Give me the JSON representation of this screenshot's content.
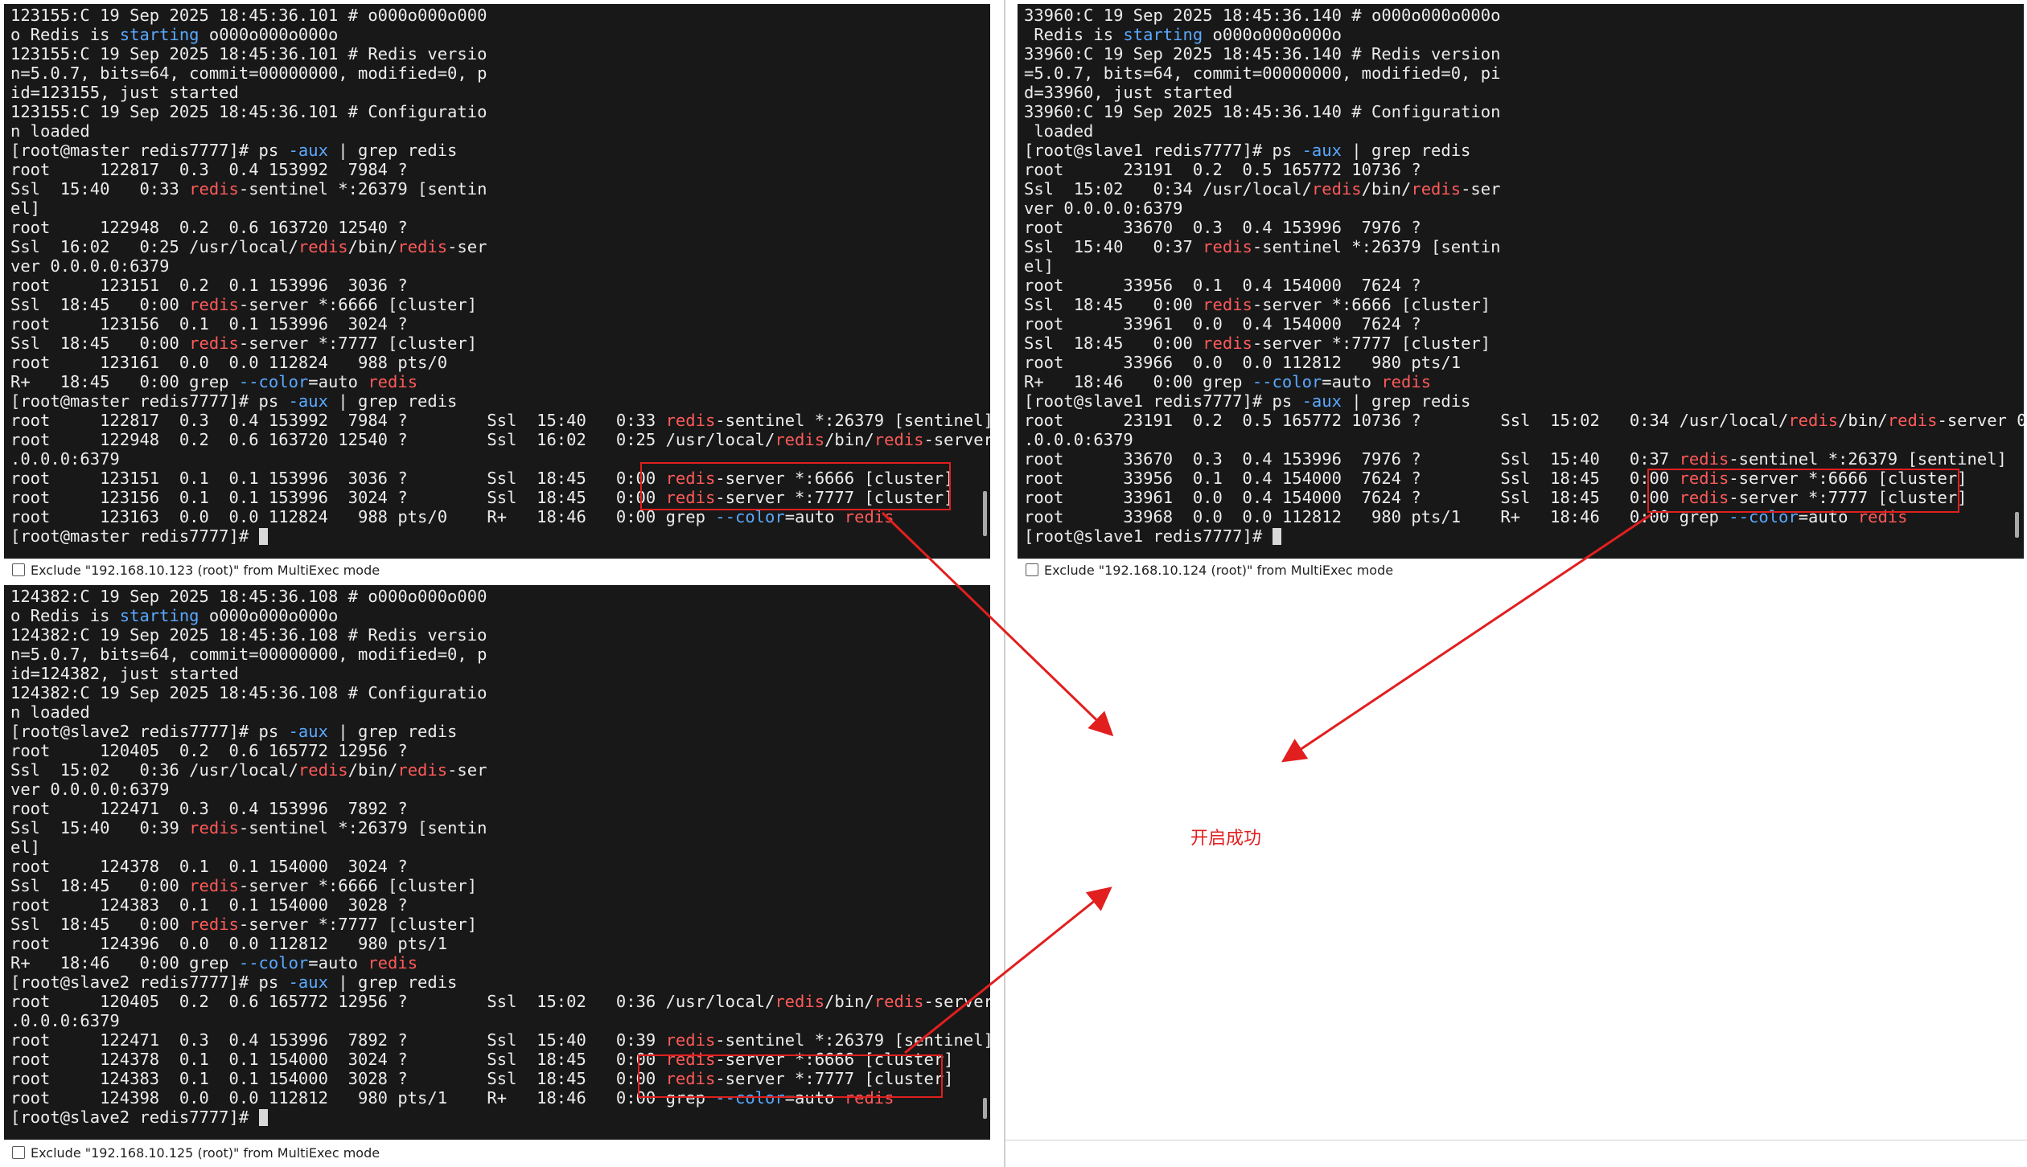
{
  "colors": {
    "terminal_bg": "#181818",
    "text": "#ececec",
    "redis_highlight": "#ff5a5a",
    "flag_highlight": "#5aa9ff",
    "annotation": "#e11f1f"
  },
  "panes": [
    {
      "host": "master",
      "exclude_label": "Exclude \"192.168.10.123 (root)\" from MultiExec mode",
      "lines": [
        [
          [
            "123155:C 19 Sep 2025 18:45:36.101 # o000o000o000",
            ""
          ]
        ],
        [
          [
            "o Redis is ",
            ""
          ],
          [
            "starting",
            "b"
          ],
          [
            " o000o000o000o",
            ""
          ]
        ],
        [
          [
            "123155:C 19 Sep 2025 18:45:36.101 # Redis versio",
            ""
          ]
        ],
        [
          [
            "n=5.0.7, bits=64, commit=00000000, modified=0, p",
            ""
          ]
        ],
        [
          [
            "id=123155, just started",
            ""
          ]
        ],
        [
          [
            "123155:C 19 Sep 2025 18:45:36.101 # Configuratio",
            ""
          ]
        ],
        [
          [
            "n loaded",
            ""
          ]
        ],
        [
          [
            "[root@master redis7777]# ps ",
            ""
          ],
          [
            "-aux",
            "b"
          ],
          [
            " | grep redis",
            ""
          ]
        ],
        [
          [
            "root     122817  0.3  0.4 153992  7984 ?",
            ""
          ]
        ],
        [
          [
            "Ssl  15:40   0:33 ",
            ""
          ],
          [
            "redis",
            "r"
          ],
          [
            "-sentinel *:26379 [sentin",
            ""
          ]
        ],
        [
          [
            "el]",
            ""
          ]
        ],
        [
          [
            "root     122948  0.2  0.6 163720 12540 ?",
            ""
          ]
        ],
        [
          [
            "Ssl  16:02   0:25 /usr/local/",
            ""
          ],
          [
            "redis",
            "r"
          ],
          [
            "/bin/",
            ""
          ],
          [
            "redis",
            "r"
          ],
          [
            "-ser",
            ""
          ]
        ],
        [
          [
            "ver 0.0.0.0:6379",
            ""
          ]
        ],
        [
          [
            "root     123151  0.2  0.1 153996  3036 ?",
            ""
          ]
        ],
        [
          [
            "Ssl  18:45   0:00 ",
            ""
          ],
          [
            "redis",
            "r"
          ],
          [
            "-server *:6666 [cluster]",
            ""
          ]
        ],
        [
          [
            "root     123156  0.1  0.1 153996  3024 ?",
            ""
          ]
        ],
        [
          [
            "Ssl  18:45   0:00 ",
            ""
          ],
          [
            "redis",
            "r"
          ],
          [
            "-server *:7777 [cluster]",
            ""
          ]
        ],
        [
          [
            "root     123161  0.0  0.0 112824   988 pts/0",
            ""
          ]
        ],
        [
          [
            "R+   18:45   0:00 grep ",
            ""
          ],
          [
            "--color",
            "b"
          ],
          [
            "=auto ",
            ""
          ],
          [
            "redis",
            "r"
          ]
        ],
        [
          [
            "[root@master redis7777]# ps ",
            ""
          ],
          [
            "-aux",
            "b"
          ],
          [
            " | grep redis",
            ""
          ]
        ],
        [
          [
            "root     122817  0.3  0.4 153992  7984 ?        Ssl  15:40   0:33 ",
            ""
          ],
          [
            "redis",
            "r"
          ],
          [
            "-sentinel *:26379 [sentinel]",
            ""
          ]
        ],
        [
          [
            "root     122948  0.2  0.6 163720 12540 ?        Ssl  16:02   0:25 /usr/local/",
            ""
          ],
          [
            "redis",
            "r"
          ],
          [
            "/bin/",
            ""
          ],
          [
            "redis",
            "r"
          ],
          [
            "-server 0",
            ""
          ]
        ],
        [
          [
            ".0.0.0:6379",
            ""
          ]
        ],
        [
          [
            "root     123151  0.1  0.1 153996  3036 ?        Ssl  18:45   0:00 ",
            ""
          ],
          [
            "redis",
            "r"
          ],
          [
            "-server *:6666 [cluster]",
            ""
          ]
        ],
        [
          [
            "root     123156  0.1  0.1 153996  3024 ?        Ssl  18:45   0:00 ",
            ""
          ],
          [
            "redis",
            "r"
          ],
          [
            "-server *:7777 [cluster]",
            ""
          ]
        ],
        [
          [
            "root     123163  0.0  0.0 112824   988 pts/0    R+   18:46   0:00 grep ",
            ""
          ],
          [
            "--color",
            "b"
          ],
          [
            "=auto ",
            ""
          ],
          [
            "redis",
            "r"
          ]
        ],
        [
          [
            "[root@master redis7777]# ",
            ""
          ],
          [
            "",
            "c"
          ]
        ]
      ]
    },
    {
      "host": "slave1",
      "exclude_label": "Exclude \"192.168.10.124 (root)\" from MultiExec mode",
      "lines": [
        [
          [
            "33960:C 19 Sep 2025 18:45:36.140 # o000o000o000o",
            ""
          ]
        ],
        [
          [
            " Redis is ",
            ""
          ],
          [
            "starting",
            "b"
          ],
          [
            " o000o000o000o",
            ""
          ]
        ],
        [
          [
            "33960:C 19 Sep 2025 18:45:36.140 # Redis version",
            ""
          ]
        ],
        [
          [
            "=5.0.7, bits=64, commit=00000000, modified=0, pi",
            ""
          ]
        ],
        [
          [
            "d=33960, just started",
            ""
          ]
        ],
        [
          [
            "33960:C 19 Sep 2025 18:45:36.140 # Configuration",
            ""
          ]
        ],
        [
          [
            " loaded",
            ""
          ]
        ],
        [
          [
            "[root@slave1 redis7777]# ps ",
            ""
          ],
          [
            "-aux",
            "b"
          ],
          [
            " | grep redis",
            ""
          ]
        ],
        [
          [
            "root      23191  0.2  0.5 165772 10736 ?",
            ""
          ]
        ],
        [
          [
            "Ssl  15:02   0:34 /usr/local/",
            ""
          ],
          [
            "redis",
            "r"
          ],
          [
            "/bin/",
            ""
          ],
          [
            "redis",
            "r"
          ],
          [
            "-ser",
            ""
          ]
        ],
        [
          [
            "ver 0.0.0.0:6379",
            ""
          ]
        ],
        [
          [
            "root      33670  0.3  0.4 153996  7976 ?",
            ""
          ]
        ],
        [
          [
            "Ssl  15:40   0:37 ",
            ""
          ],
          [
            "redis",
            "r"
          ],
          [
            "-sentinel *:26379 [sentin",
            ""
          ]
        ],
        [
          [
            "el]",
            ""
          ]
        ],
        [
          [
            "root      33956  0.1  0.4 154000  7624 ?",
            ""
          ]
        ],
        [
          [
            "Ssl  18:45   0:00 ",
            ""
          ],
          [
            "redis",
            "r"
          ],
          [
            "-server *:6666 [cluster]",
            ""
          ]
        ],
        [
          [
            "root      33961  0.0  0.4 154000  7624 ?",
            ""
          ]
        ],
        [
          [
            "Ssl  18:45   0:00 ",
            ""
          ],
          [
            "redis",
            "r"
          ],
          [
            "-server *:7777 [cluster]",
            ""
          ]
        ],
        [
          [
            "root      33966  0.0  0.0 112812   980 pts/1",
            ""
          ]
        ],
        [
          [
            "R+   18:46   0:00 grep ",
            ""
          ],
          [
            "--color",
            "b"
          ],
          [
            "=auto ",
            ""
          ],
          [
            "redis",
            "r"
          ]
        ],
        [
          [
            "[root@slave1 redis7777]# ps ",
            ""
          ],
          [
            "-aux",
            "b"
          ],
          [
            " | grep redis",
            ""
          ]
        ],
        [
          [
            "root      23191  0.2  0.5 165772 10736 ?        Ssl  15:02   0:34 /usr/local/",
            ""
          ],
          [
            "redis",
            "r"
          ],
          [
            "/bin/",
            ""
          ],
          [
            "redis",
            "r"
          ],
          [
            "-server 0",
            ""
          ]
        ],
        [
          [
            ".0.0.0:6379",
            ""
          ]
        ],
        [
          [
            "root      33670  0.3  0.4 153996  7976 ?        Ssl  15:40   0:37 ",
            ""
          ],
          [
            "redis",
            "r"
          ],
          [
            "-sentinel *:26379 [sentinel]",
            ""
          ]
        ],
        [
          [
            "root      33956  0.1  0.4 154000  7624 ?        Ssl  18:45   0:00 ",
            ""
          ],
          [
            "redis",
            "r"
          ],
          [
            "-server *:6666 [cluster]",
            ""
          ]
        ],
        [
          [
            "root      33961  0.0  0.4 154000  7624 ?        Ssl  18:45   0:00 ",
            ""
          ],
          [
            "redis",
            "r"
          ],
          [
            "-server *:7777 [cluster]",
            ""
          ]
        ],
        [
          [
            "root      33968  0.0  0.0 112812   980 pts/1    R+   18:46   0:00 grep ",
            ""
          ],
          [
            "--color",
            "b"
          ],
          [
            "=auto ",
            ""
          ],
          [
            "redis",
            "r"
          ]
        ],
        [
          [
            "[root@slave1 redis7777]# ",
            ""
          ],
          [
            "",
            "c"
          ]
        ]
      ]
    },
    {
      "host": "slave2",
      "exclude_label": "Exclude \"192.168.10.125 (root)\" from MultiExec mode",
      "lines": [
        [
          [
            "124382:C 19 Sep 2025 18:45:36.108 # o000o000o000",
            ""
          ]
        ],
        [
          [
            "o Redis is ",
            ""
          ],
          [
            "starting",
            "b"
          ],
          [
            " o000o000o000o",
            ""
          ]
        ],
        [
          [
            "124382:C 19 Sep 2025 18:45:36.108 # Redis versio",
            ""
          ]
        ],
        [
          [
            "n=5.0.7, bits=64, commit=00000000, modified=0, p",
            ""
          ]
        ],
        [
          [
            "id=124382, just started",
            ""
          ]
        ],
        [
          [
            "124382:C 19 Sep 2025 18:45:36.108 # Configuratio",
            ""
          ]
        ],
        [
          [
            "n loaded",
            ""
          ]
        ],
        [
          [
            "[root@slave2 redis7777]# ps ",
            ""
          ],
          [
            "-aux",
            "b"
          ],
          [
            " | grep redis",
            ""
          ]
        ],
        [
          [
            "root     120405  0.2  0.6 165772 12956 ?",
            ""
          ]
        ],
        [
          [
            "Ssl  15:02   0:36 /usr/local/",
            ""
          ],
          [
            "redis",
            "r"
          ],
          [
            "/bin/",
            ""
          ],
          [
            "redis",
            "r"
          ],
          [
            "-ser",
            ""
          ]
        ],
        [
          [
            "ver 0.0.0.0:6379",
            ""
          ]
        ],
        [
          [
            "root     122471  0.3  0.4 153996  7892 ?",
            ""
          ]
        ],
        [
          [
            "Ssl  15:40   0:39 ",
            ""
          ],
          [
            "redis",
            "r"
          ],
          [
            "-sentinel *:26379 [sentin",
            ""
          ]
        ],
        [
          [
            "el]",
            ""
          ]
        ],
        [
          [
            "root     124378  0.1  0.1 154000  3024 ?",
            ""
          ]
        ],
        [
          [
            "Ssl  18:45   0:00 ",
            ""
          ],
          [
            "redis",
            "r"
          ],
          [
            "-server *:6666 [cluster]",
            ""
          ]
        ],
        [
          [
            "root     124383  0.1  0.1 154000  3028 ?",
            ""
          ]
        ],
        [
          [
            "Ssl  18:45   0:00 ",
            ""
          ],
          [
            "redis",
            "r"
          ],
          [
            "-server *:7777 [cluster]",
            ""
          ]
        ],
        [
          [
            "root     124396  0.0  0.0 112812   980 pts/1",
            ""
          ]
        ],
        [
          [
            "R+   18:46   0:00 grep ",
            ""
          ],
          [
            "--color",
            "b"
          ],
          [
            "=auto ",
            ""
          ],
          [
            "redis",
            "r"
          ]
        ],
        [
          [
            "[root@slave2 redis7777]# ps ",
            ""
          ],
          [
            "-aux",
            "b"
          ],
          [
            " | grep redis",
            ""
          ]
        ],
        [
          [
            "root     120405  0.2  0.6 165772 12956 ?        Ssl  15:02   0:36 /usr/local/",
            ""
          ],
          [
            "redis",
            "r"
          ],
          [
            "/bin/",
            ""
          ],
          [
            "redis",
            "r"
          ],
          [
            "-server 0",
            ""
          ]
        ],
        [
          [
            ".0.0.0:6379",
            ""
          ]
        ],
        [
          [
            "root     122471  0.3  0.4 153996  7892 ?        Ssl  15:40   0:39 ",
            ""
          ],
          [
            "redis",
            "r"
          ],
          [
            "-sentinel *:26379 [sentinel]",
            ""
          ]
        ],
        [
          [
            "root     124378  0.1  0.1 154000  3024 ?        Ssl  18:45   0:00 ",
            ""
          ],
          [
            "redis",
            "r"
          ],
          [
            "-server *:6666 [cluster]",
            ""
          ]
        ],
        [
          [
            "root     124383  0.1  0.1 154000  3028 ?        Ssl  18:45   0:00 ",
            ""
          ],
          [
            "redis",
            "r"
          ],
          [
            "-server *:7777 [cluster]",
            ""
          ]
        ],
        [
          [
            "root     124398  0.0  0.0 112812   980 pts/1    R+   18:46   0:00 grep ",
            ""
          ],
          [
            "--color",
            "b"
          ],
          [
            "=auto ",
            ""
          ],
          [
            "redis",
            "r"
          ]
        ],
        [
          [
            "[root@slave2 redis7777]# ",
            ""
          ],
          [
            "",
            "c"
          ]
        ]
      ]
    }
  ],
  "annotation": {
    "text": "开启成功"
  }
}
